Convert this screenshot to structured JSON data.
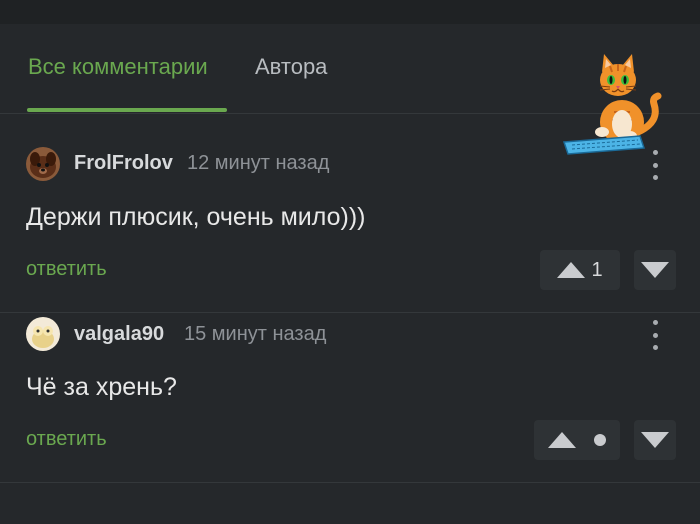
{
  "tabs": [
    {
      "label": "Все комментарии",
      "active": true
    },
    {
      "label": "Автора",
      "active": false
    }
  ],
  "colors": {
    "accent": "#6aa84f",
    "background": "#25282b",
    "muted_text": "#8e9297"
  },
  "comments": [
    {
      "username": "FrolFrolov",
      "time": "12 минут назад",
      "text": "Держи плюсик, очень мило)))",
      "reply_label": "ответить",
      "rating": "1",
      "avatar_icon": "dog-avatar"
    },
    {
      "username": "valgala90",
      "time": "15 минут назад",
      "text": "Чё за хрень?",
      "reply_label": "ответить",
      "rating": "",
      "rating_hidden": true,
      "avatar_icon": "cartoon-avatar"
    }
  ],
  "decoration": {
    "icon": "cat-typing-keyboard-icon"
  }
}
